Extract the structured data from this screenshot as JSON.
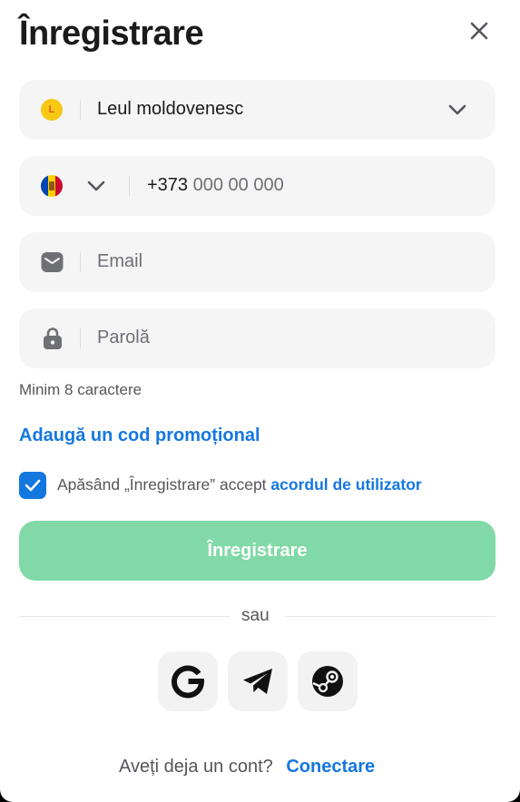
{
  "modal": {
    "title": "Înregistrare",
    "close_icon": "close-icon"
  },
  "currency": {
    "coin_letter": "L",
    "value": "Leul moldovenesc",
    "icon": "moldovan-leu-coin-icon"
  },
  "phone": {
    "country_flag": "moldova-flag-icon",
    "prefix": "+373",
    "placeholder": "000 00 000"
  },
  "email": {
    "icon": "envelope-icon",
    "placeholder": "Email"
  },
  "password": {
    "icon": "lock-icon",
    "placeholder": "Parolă",
    "hint": "Minim 8 caractere"
  },
  "promo": {
    "link_label": "Adaugă un cod promoțional"
  },
  "agreement": {
    "checked": true,
    "text": "Apăsând „Înregistrare” accept",
    "link_label": "acordul de utilizator"
  },
  "submit": {
    "label": "Înregistrare"
  },
  "divider": {
    "label": "sau"
  },
  "social": [
    {
      "icon": "google-icon"
    },
    {
      "icon": "telegram-icon"
    },
    {
      "icon": "steam-icon"
    }
  ],
  "footer": {
    "question": "Aveți deja un cont?",
    "login_label": "Conectare"
  },
  "colors": {
    "accent": "#1477e0",
    "submit_disabled": "#80d9a6",
    "field_bg": "#f5f5f6"
  }
}
